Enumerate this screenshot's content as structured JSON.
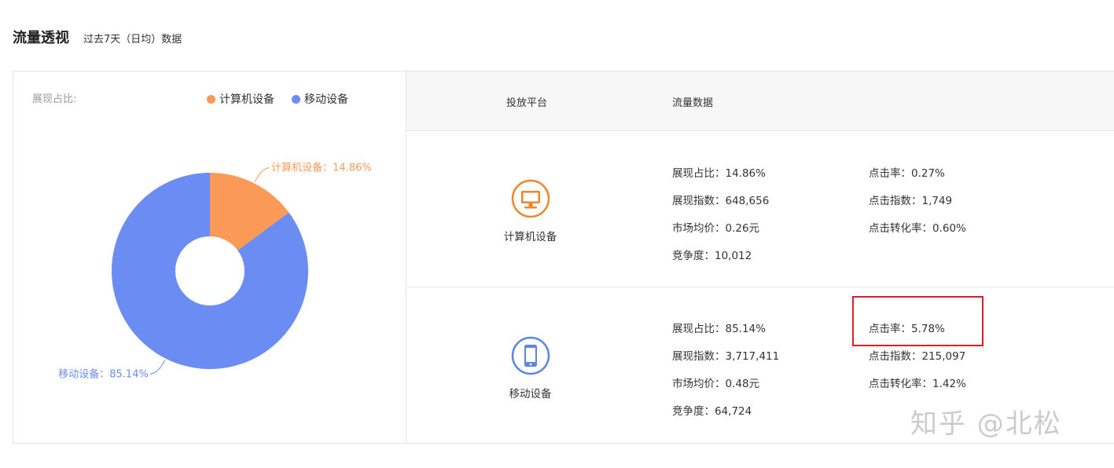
{
  "header": {
    "title": "流量透视",
    "subtitle": "过去7天（日均）数据"
  },
  "left_panel": {
    "ratio_label": "展现占比:",
    "legend": [
      {
        "label": "计算机设备",
        "color": "#fb9a56"
      },
      {
        "label": "移动设备",
        "color": "#6b8cf3"
      }
    ]
  },
  "chart_data": {
    "type": "pie",
    "title": "",
    "labels": [
      "计算机设备",
      "移动设备"
    ],
    "values": [
      14.86,
      85.14
    ],
    "unit": "%",
    "colors": [
      "#fb9a56",
      "#6b8cf3"
    ],
    "data_labels": [
      "计算机设备：14.86%",
      "移动设备：85.14%"
    ],
    "donut": true,
    "legend_position": "top-right"
  },
  "table": {
    "headers": {
      "platform": "投放平台",
      "traffic": "流量数据"
    },
    "rows": [
      {
        "platform": "计算机设备",
        "icon": "monitor-icon",
        "icon_color": "#f0862a",
        "metrics_left": [
          "展现占比：14.86%",
          "展现指数：648,656",
          "市场均价：0.26元",
          "竞争度：10,012"
        ],
        "metrics_right": [
          "点击率：0.27%",
          "点击指数：1,749",
          "点击转化率：0.60%"
        ]
      },
      {
        "platform": "移动设备",
        "icon": "phone-icon",
        "icon_color": "#5b86e5",
        "metrics_left": [
          "展现占比：85.14%",
          "展现指数：3,717,411",
          "市场均价：0.48元",
          "竞争度：64,724"
        ],
        "metrics_right": [
          "点击率：5.78%",
          "点击指数：215,097",
          "点击转化率：1.42%"
        ]
      }
    ]
  },
  "watermark": "知乎 @北松"
}
